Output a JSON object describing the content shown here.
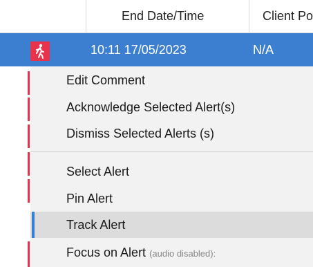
{
  "table": {
    "headers": [
      "End Date/Time",
      "Client Po"
    ],
    "row": {
      "icon": "walking-person-icon",
      "end_datetime": "10:11 17/05/2023",
      "client": "N/A"
    }
  },
  "context_menu": {
    "items": [
      {
        "label": "Edit Comment"
      },
      {
        "label": "Acknowledge Selected Alert(s)"
      },
      {
        "label": "Dismiss Selected Alerts (s)"
      },
      {
        "label": "Select Alert"
      },
      {
        "label": "Pin Alert"
      },
      {
        "label": "Track Alert"
      },
      {
        "label": "Focus on Alert",
        "suffix": "(audio disabled):"
      }
    ],
    "highlighted": "Track Alert"
  },
  "colors": {
    "selection": "#3c7fd0",
    "alert_red": "#e8334a",
    "menu_bg": "#f2f2f2",
    "hover_bg": "#dcdcdc"
  }
}
